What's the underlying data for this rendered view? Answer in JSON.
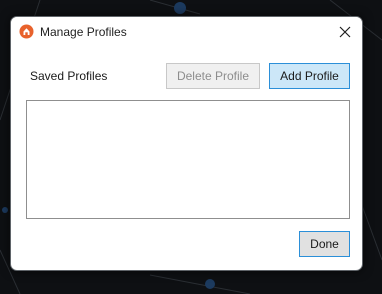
{
  "window": {
    "title": "Manage Profiles",
    "close_glyph": "✕",
    "app_icon": "app-logo-icon"
  },
  "profiles": {
    "section_label": "Saved Profiles",
    "delete_label": "Delete Profile",
    "add_label": "Add Profile",
    "items": []
  },
  "footer": {
    "done_label": "Done"
  },
  "colors": {
    "accent": "#2b8fd8",
    "add_button_bg": "#cce7f8",
    "disabled_text": "#8d8d8d",
    "icon_orange": "#e8622c"
  }
}
